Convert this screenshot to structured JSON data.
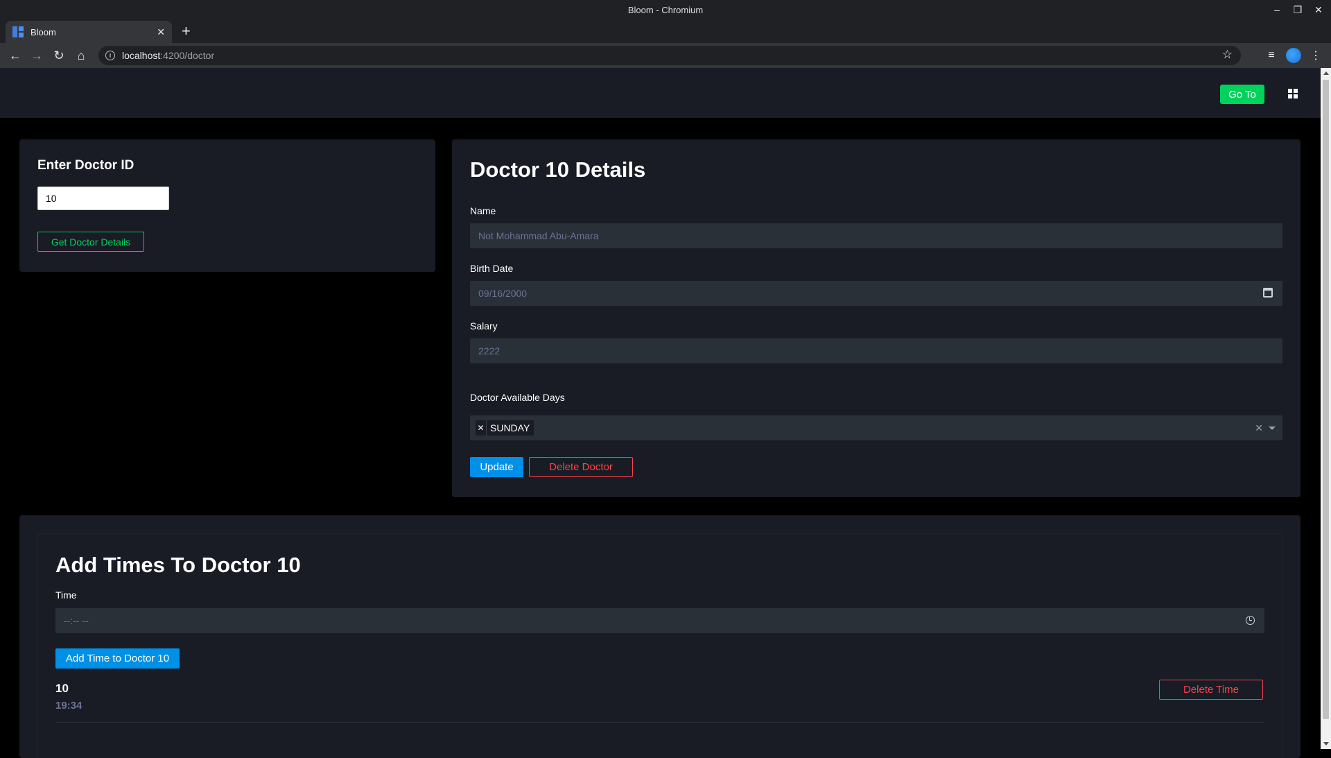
{
  "browser": {
    "window_title": "Bloom - Chromium",
    "tab_title": "Bloom",
    "url_host": "localhost",
    "url_path": ":4200/doctor"
  },
  "appbar": {
    "goto_label": "Go To"
  },
  "lookup": {
    "heading": "Enter Doctor ID",
    "doctor_id_value": "10",
    "get_button_label": "Get Doctor Details"
  },
  "details": {
    "heading": "Doctor 10 Details",
    "name_label": "Name",
    "name_value": "Not Mohammad Abu-Amara",
    "birth_label": "Birth Date",
    "birth_value": "09/16/2000",
    "salary_label": "Salary",
    "salary_value": "2222",
    "days_label": "Doctor Available Days",
    "selected_days": [
      "SUNDAY"
    ],
    "update_label": "Update",
    "delete_label": "Delete Doctor"
  },
  "times": {
    "heading": "Add Times To Doctor 10",
    "time_label": "Time",
    "time_placeholder": "--:-- --",
    "add_button_label": "Add Time to Doctor 10",
    "entries": [
      {
        "id": "10",
        "time": "19:34",
        "delete_label": "Delete Time"
      }
    ]
  },
  "colors": {
    "accent_green": "#00d25b",
    "accent_blue": "#0090e7",
    "danger_red": "#fc424a",
    "card_bg": "#191c24",
    "field_bg": "#2a3038"
  }
}
